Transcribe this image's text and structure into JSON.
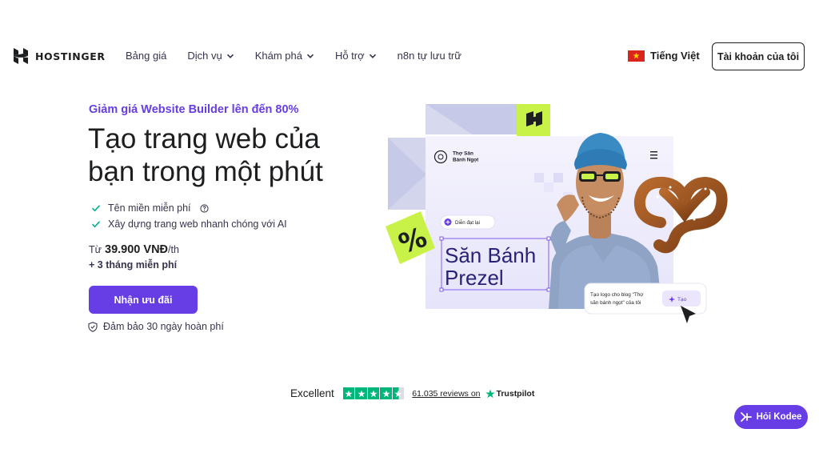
{
  "brand": {
    "name": "HOSTINGER"
  },
  "nav": {
    "items": [
      {
        "label": "Bảng giá",
        "has_dropdown": false
      },
      {
        "label": "Dịch vụ",
        "has_dropdown": true
      },
      {
        "label": "Khám phá",
        "has_dropdown": true
      },
      {
        "label": "Hỗ trợ",
        "has_dropdown": true
      },
      {
        "label": "n8n tự lưu trữ",
        "has_dropdown": false
      }
    ],
    "language": "Tiếng Việt",
    "account_label": "Tài khoản của tôi"
  },
  "hero": {
    "promo": "Giảm giá Website Builder lên đến 80%",
    "headline_line1": "Tạo trang web của",
    "headline_line2": "bạn trong một phút",
    "features": [
      "Tên miền miễn phí",
      "Xây dựng trang web nhanh chóng với AI"
    ],
    "price_prefix": "Từ",
    "price_value": "39.900 VNĐ",
    "price_suffix": "/th",
    "bonus": "+ 3 tháng miễn phí",
    "cta_label": "Nhận ưu đãi",
    "guarantee": "Đảm bảo 30 ngày hoàn phí"
  },
  "illustration": {
    "site_name_line1": "Thợ Săn",
    "site_name_line2": "Bánh Ngọt",
    "rephrase_chip": "Diễn đạt lại",
    "title_line1": "Săn Bánh",
    "title_line2": "Prezel",
    "percent_badge": "%",
    "prompt_line1": "Tạo logo cho blog \"Thợ",
    "prompt_line2": "săn bánh ngọt\" của tôi",
    "generate_label": "Tạo"
  },
  "trustpilot": {
    "label": "Excellent",
    "rating_stars": 4.5,
    "reviews_text": "61.035 reviews on",
    "brand": "Trustpilot"
  },
  "chat": {
    "label": "Hỏi Kodee"
  },
  "colors": {
    "accent": "#673de6",
    "text": "#1d1e20",
    "trust_green": "#00b67a",
    "lime": "#c9f249"
  }
}
